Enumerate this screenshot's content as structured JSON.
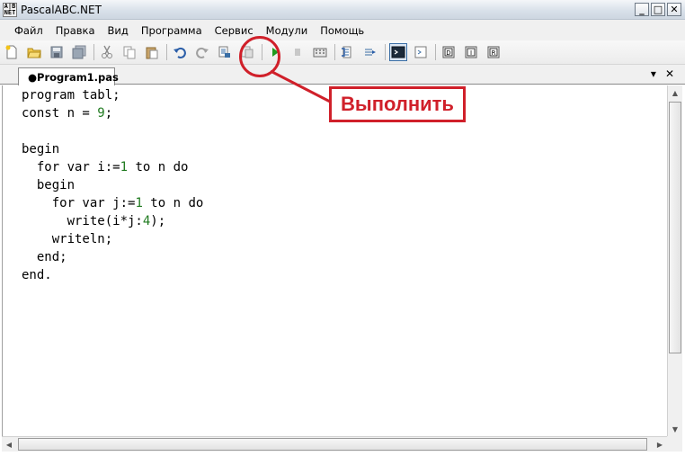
{
  "window": {
    "title": "PascalABC.NET",
    "icon_text": "ABC.NET",
    "controls": [
      "_",
      "□",
      "✕"
    ]
  },
  "menu": {
    "items": [
      "Файл",
      "Правка",
      "Вид",
      "Программа",
      "Сервис",
      "Модули",
      "Помощь"
    ]
  },
  "toolbar": {
    "buttons": [
      "new-file-icon",
      "open-folder-icon",
      "save-icon",
      "save-all-icon",
      "cut-icon",
      "copy-icon",
      "paste-icon",
      "undo-icon",
      "redo-icon",
      "find-icon",
      "replace-icon",
      "run-icon",
      "stop-icon",
      "compile-icon",
      "step-over-icon",
      "step-into-icon",
      "output-window-icon",
      "immediate-window-icon",
      "debug-stop-icon",
      "debug-into-icon",
      "debug-run-icon"
    ]
  },
  "tabs": [
    {
      "label": "●Program1.pas"
    }
  ],
  "tab_controls": {
    "dropdown": "▾",
    "close": "✕"
  },
  "editor": {
    "lines": [
      [
        {
          "t": "program tabl;",
          "c": "kw"
        }
      ],
      [
        {
          "t": "const n = ",
          "c": "kw"
        },
        {
          "t": "9",
          "c": "num"
        },
        {
          "t": ";",
          "c": "kw"
        }
      ],
      [
        {
          "t": "",
          "c": "kw"
        }
      ],
      [
        {
          "t": "begin",
          "c": "kw"
        }
      ],
      [
        {
          "t": "  for var i:=",
          "c": "kw"
        },
        {
          "t": "1",
          "c": "num"
        },
        {
          "t": " to n do",
          "c": "kw"
        }
      ],
      [
        {
          "t": "  begin",
          "c": "kw"
        }
      ],
      [
        {
          "t": "    for var j:=",
          "c": "kw"
        },
        {
          "t": "1",
          "c": "num"
        },
        {
          "t": " to n do",
          "c": "kw"
        }
      ],
      [
        {
          "t": "      write(i*j:",
          "c": "kw"
        },
        {
          "t": "4",
          "c": "num"
        },
        {
          "t": ");",
          "c": "kw"
        }
      ],
      [
        {
          "t": "    writeln;",
          "c": "kw"
        }
      ],
      [
        {
          "t": "  end;",
          "c": "kw"
        }
      ],
      [
        {
          "t": "end.",
          "c": "kw"
        }
      ]
    ]
  },
  "annotation": {
    "label": "Выполнить",
    "color": "#d0202a"
  },
  "colors": {
    "number_literal": "#1f7a1f",
    "annotation_red": "#d0202a",
    "run_green": "#1e9a1e"
  }
}
